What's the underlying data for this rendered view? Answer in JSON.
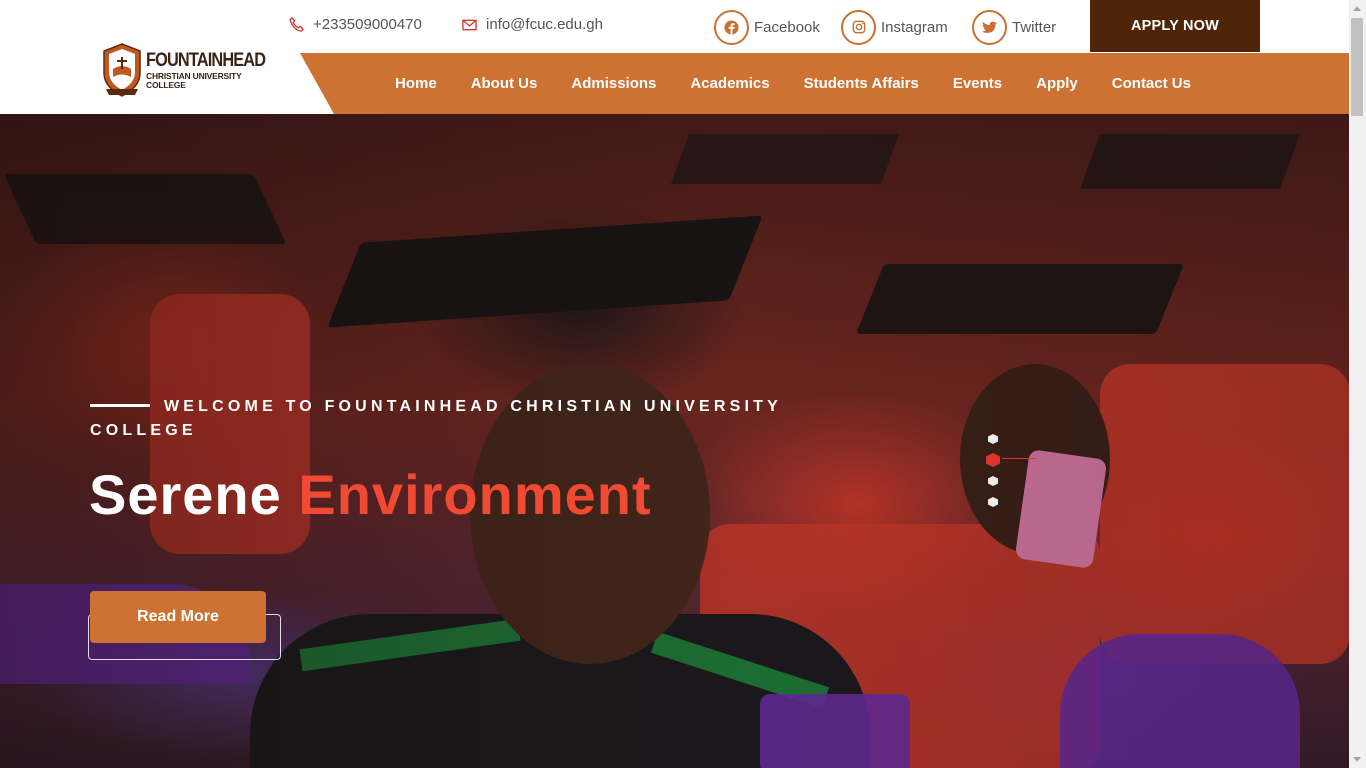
{
  "header": {
    "logo": {
      "title": "FOUNTAINHEAD",
      "subtitle_line1": "CHRISTIAN UNIVERSITY",
      "subtitle_line2": "COLLEGE",
      "icon": "university-crest-icon"
    },
    "contact": {
      "phone": "+233509000470",
      "phone_icon": "phone-icon",
      "email": "info@fcuc.edu.gh",
      "email_icon": "envelope-icon"
    },
    "social": [
      {
        "label": "Facebook",
        "icon": "facebook-icon"
      },
      {
        "label": "Instagram",
        "icon": "instagram-icon"
      },
      {
        "label": "Twitter",
        "icon": "twitter-icon"
      }
    ],
    "apply_now": "APPLY NOW"
  },
  "nav": {
    "items": [
      "Home",
      "About Us",
      "Admissions",
      "Academics",
      "Students Affairs",
      "Events",
      "Apply",
      "Contact Us"
    ]
  },
  "hero": {
    "tagline": "WELCOME TO FOUNTAINHEAD CHRISTIAN UNIVERSITY COLLEGE",
    "headline_white": "Serene",
    "headline_accent": "Environment",
    "button": "Read More",
    "slides_total": 4,
    "active_slide": 2
  },
  "colors": {
    "brand_orange": "#cd7233",
    "brand_brown": "#4e2508",
    "accent_red": "#f04a33"
  }
}
